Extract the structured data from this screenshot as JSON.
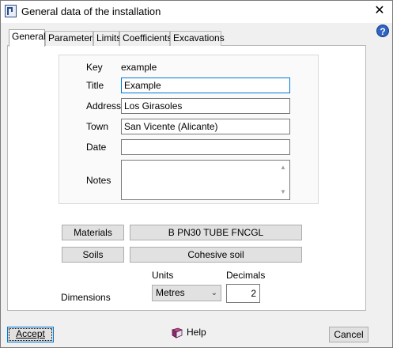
{
  "window": {
    "title": "General data of the installation",
    "close_glyph": "✕",
    "help_glyph": "?"
  },
  "tabs": [
    {
      "label": "General",
      "active": true
    },
    {
      "label": "Parameters",
      "active": false
    },
    {
      "label": "Limits",
      "active": false
    },
    {
      "label": "Coefficients",
      "active": false
    },
    {
      "label": "Excavations",
      "active": false
    }
  ],
  "general": {
    "key_label": "Key",
    "key_value": "example",
    "title_label": "Title",
    "title_value": "Example",
    "address_label": "Address",
    "address_value": "Los Girasoles",
    "town_label": "Town",
    "town_value": "San Vicente (Alicante)",
    "date_label": "Date",
    "date_value": "",
    "notes_label": "Notes",
    "notes_value": ""
  },
  "materials": {
    "button_label": "Materials",
    "value": "B PN30 TUBE FNCGL"
  },
  "soils": {
    "button_label": "Soils",
    "value": "Cohesive soil"
  },
  "dimensions": {
    "label": "Dimensions",
    "units_label": "Units",
    "units_value": "Metres",
    "decimals_label": "Decimals",
    "decimals_value": "2"
  },
  "footer": {
    "accept_label": "Accept",
    "help_label": "Help",
    "cancel_label": "Cancel"
  },
  "colors": {
    "focus_border": "#0078d7",
    "help_icon": "#2f63c4"
  }
}
